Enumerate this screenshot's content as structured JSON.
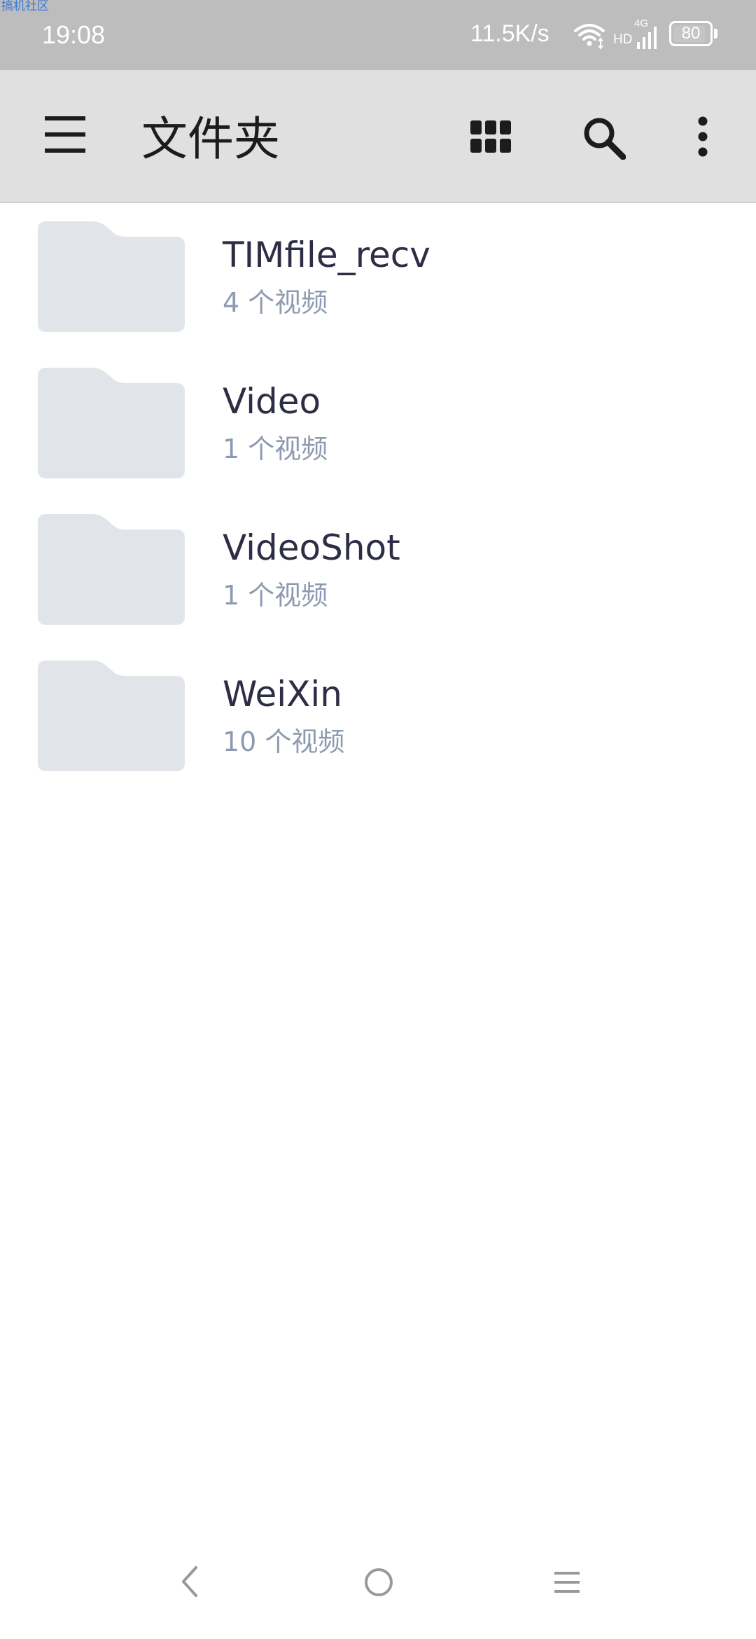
{
  "status_bar": {
    "watermark": "搞机社区",
    "time": "19:08",
    "network_speed": "11.5K/s",
    "hd_label": "HD",
    "network_type": "4G",
    "battery_level": "80",
    "icons": [
      "wifi-icon",
      "signal-icon",
      "battery-icon"
    ]
  },
  "toolbar": {
    "title": "文件夹",
    "icons": [
      "menu-icon",
      "grid-view-icon",
      "search-icon",
      "more-options-icon"
    ]
  },
  "folders": [
    {
      "name": "TIMfile_recv",
      "count": "4 个视频"
    },
    {
      "name": "Video",
      "count": "1 个视频"
    },
    {
      "name": "VideoShot",
      "count": "1 个视频"
    },
    {
      "name": "WeiXin",
      "count": "10 个视频"
    }
  ],
  "nav_bar": {
    "icons": [
      "back-icon",
      "home-icon",
      "recent-apps-icon"
    ]
  },
  "colors": {
    "status_bar_bg": "#bdbdbd",
    "toolbar_bg": "#e0e0e0",
    "folder_thumb": "#e1e4e9",
    "folder_name": "#2d2d45",
    "folder_count": "#8e9ab0",
    "nav_icon": "#999999"
  }
}
